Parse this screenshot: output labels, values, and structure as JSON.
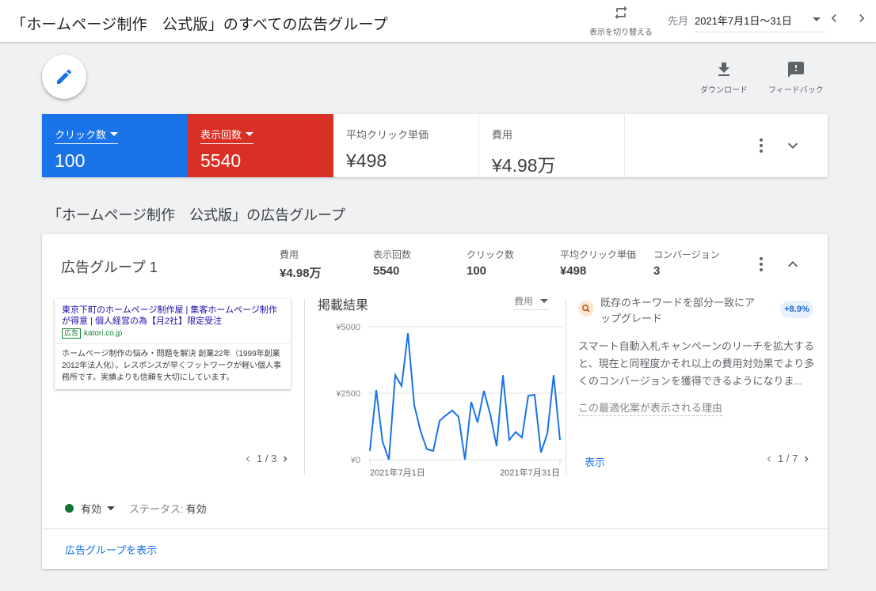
{
  "header": {
    "title": "「ホームページ制作　公式版」のすべての広告グループ",
    "toggle_view_label": "表示を切り替える",
    "date_prefix": "先月",
    "date_range": "2021年7月1日～31日"
  },
  "toolbar": {
    "download_label": "ダウンロード",
    "feedback_label": "フィードバック"
  },
  "scorecard": {
    "metrics": [
      {
        "label": "クリック数",
        "value": "100",
        "color": "#1a73e8",
        "selectable": true
      },
      {
        "label": "表示回数",
        "value": "5540",
        "color": "#d93025",
        "selectable": true
      },
      {
        "label": "平均クリック単価",
        "value": "¥498"
      },
      {
        "label": "費用",
        "value": "¥4.98万"
      }
    ]
  },
  "section": {
    "title": "「ホームページ制作　公式版」の広告グループ"
  },
  "ad_group": {
    "name": "広告グループ 1",
    "stats": [
      {
        "label": "費用",
        "value": "¥4.98万"
      },
      {
        "label": "表示回数",
        "value": "5540"
      },
      {
        "label": "クリック数",
        "value": "100"
      },
      {
        "label": "平均クリック単価",
        "value": "¥498"
      },
      {
        "label": "コンバージョン",
        "value": "3"
      }
    ],
    "ad": {
      "headline": "東京下町のホームページ制作屋 | 集客ホームページ制作が得意 | 個人経営の為【月2社】限定受注",
      "badge": "広告",
      "url": "katori.co.jp",
      "description": "ホームページ制作の悩み・問題を解決 創業22年（1999年創業 2012年法人化）。レスポンスが早くフットワークが軽い個人事務所です。実績よりも信頼を大切にしています。",
      "pager": "1 / 3"
    },
    "chart_title": "掲載結果",
    "chart_metric": "費用",
    "recommendation": {
      "title": "既存のキーワードを部分一致にアップグレード",
      "uplift": "+8.9%",
      "description": "スマート自動入札キャンペーンのリーチを拡大すると、現在と同程度かそれ以上の費用対効果でより多くのコンバージョンを獲得できるようになりま...",
      "why_link": "この最適化案が表示される理由",
      "show_link": "表示",
      "pager": "1 / 7"
    },
    "status": {
      "selected": "有効",
      "label": "ステータス:",
      "value": "有効",
      "color": "#137333"
    },
    "view_link": "広告グループを表示"
  },
  "chart_data": {
    "type": "line",
    "title": "掲載結果",
    "xlabel": "",
    "ylabel": "費用",
    "x_tick_labels": [
      "2021年7月1日",
      "2021年7月31日"
    ],
    "y_tick_labels": [
      "¥0",
      "¥2500",
      "¥5000"
    ],
    "ylim": [
      0,
      5000
    ],
    "grid": true,
    "series": [
      {
        "name": "費用",
        "color": "#1a73e8",
        "x": [
          1,
          2,
          3,
          4,
          5,
          6,
          7,
          8,
          9,
          10,
          11,
          12,
          13,
          14,
          15,
          16,
          17,
          18,
          19,
          20,
          21,
          22,
          23,
          24,
          25,
          26,
          27,
          28,
          29,
          30,
          31
        ],
        "values": [
          330,
          2620,
          680,
          0,
          3180,
          2770,
          4760,
          2050,
          1070,
          390,
          330,
          1460,
          1670,
          1850,
          1610,
          0,
          2170,
          1400,
          2590,
          1700,
          510,
          3180,
          740,
          1040,
          830,
          2410,
          2440,
          270,
          980,
          3180,
          740
        ]
      }
    ]
  }
}
